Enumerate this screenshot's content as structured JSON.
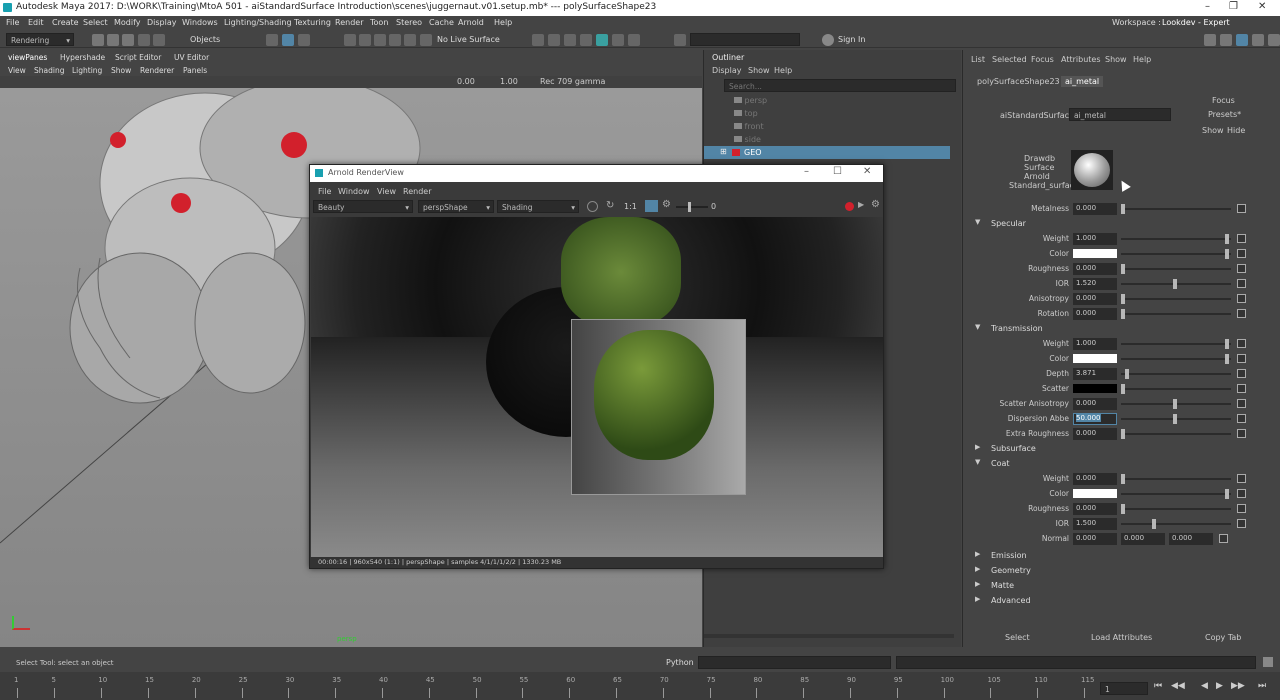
{
  "window": {
    "title": "Autodesk Maya 2017: D:\\WORK\\Training\\MtoA 501 - aiStandardSurface Introduction\\scenes\\juggernaut.v01.setup.mb*  ---  polySurfaceShape23",
    "controls": [
      "–",
      "❐",
      "✕"
    ]
  },
  "menubar": {
    "items": [
      "File",
      "Edit",
      "Create",
      "Select",
      "Modify",
      "Display",
      "Windows",
      "Lighting/Shading",
      "Texturing",
      "Render",
      "Toon",
      "Stereo",
      "Cache",
      "Arnold",
      "Help"
    ],
    "workspace_label": "Workspace :",
    "workspace_value": "Lookdev - Expert"
  },
  "shelf": {
    "menu_set": "Rendering",
    "objects_label": "Objects",
    "live_surface": "No Live Surface",
    "sign_in": "Sign In"
  },
  "viewport": {
    "tabs": [
      "viewPanes",
      "Hypershade",
      "Script Editor",
      "UV Editor"
    ],
    "menu": [
      "View",
      "Shading",
      "Lighting",
      "Show",
      "Renderer",
      "Panels"
    ],
    "field_a": "0.00",
    "field_b": "1.00",
    "color_space": "Rec 709 gamma",
    "camera_label": "persp"
  },
  "outliner": {
    "title": "Outliner",
    "menu": [
      "Display",
      "Show",
      "Help"
    ],
    "search_placeholder": "Search...",
    "items": [
      "persp",
      "top",
      "front",
      "side",
      "GEO"
    ]
  },
  "renderview": {
    "title": "Arnold RenderView",
    "menu": [
      "File",
      "Window",
      "View",
      "Render"
    ],
    "aov": "Beauty",
    "camera": "perspShape",
    "shading": "Shading",
    "ratio": "1:1",
    "exposure": "0",
    "status": "00:00:16 | 960x540 (1:1) | perspShape | samples 4/1/1/1/2/2 | 1330.23 MB"
  },
  "attr_editor": {
    "menu": [
      "List",
      "Selected",
      "Focus",
      "Attributes",
      "Show",
      "Help"
    ],
    "tabs": [
      "polySurfaceShape23",
      "ai_metal"
    ],
    "type_label": "aiStandardSurface:",
    "node_name": "ai_metal",
    "focus_btn": "Focus",
    "presets_btn": "Presets*",
    "show_btn": "Show",
    "hide_btn": "Hide",
    "swatch_caption": [
      "Drawdb",
      "Surface",
      "Arnold",
      "Standard_surface"
    ],
    "metalness": {
      "label": "Metalness",
      "value": "0.000",
      "level": 0.0
    },
    "sections": {
      "specular": "Specular",
      "transmission": "Transmission",
      "subsurface": "Subsurface",
      "coat": "Coat",
      "emission": "Emission",
      "geometry": "Geometry",
      "matte": "Matte",
      "advanced": "Advanced"
    },
    "specular_rows": [
      {
        "label": "Weight",
        "value": "1.000",
        "level": 1.0
      },
      {
        "label": "Color",
        "swatch": "#ffffff"
      },
      {
        "label": "Roughness",
        "value": "0.000",
        "level": 0.0
      },
      {
        "label": "IOR",
        "value": "1.520",
        "level": 0.5
      },
      {
        "label": "Anisotropy",
        "value": "0.000",
        "level": 0.0
      },
      {
        "label": "Rotation",
        "value": "0.000",
        "level": 0.0
      }
    ],
    "transmission_rows": [
      {
        "label": "Weight",
        "value": "1.000",
        "level": 1.0
      },
      {
        "label": "Color",
        "swatch": "#ffffff"
      },
      {
        "label": "Depth",
        "value": "3.871",
        "level": 0.04
      },
      {
        "label": "Scatter",
        "swatch": "#000000"
      },
      {
        "label": "Scatter Anisotropy",
        "value": "0.000",
        "level": 0.5
      },
      {
        "label": "Dispersion Abbe",
        "value": "50.000",
        "level": 0.5
      },
      {
        "label": "Extra Roughness",
        "value": "0.000",
        "level": 0.0
      }
    ],
    "coat_rows": [
      {
        "label": "Weight",
        "value": "0.000",
        "level": 0.0
      },
      {
        "label": "Color",
        "swatch": "#ffffff"
      },
      {
        "label": "Roughness",
        "value": "0.000",
        "level": 0.0
      },
      {
        "label": "IOR",
        "value": "1.500",
        "level": 0.3
      }
    ],
    "normal": {
      "label": "Normal",
      "values": [
        "0.000",
        "0.000",
        "0.000"
      ]
    },
    "bottom_buttons": [
      "Select",
      "Load Attributes",
      "Copy Tab"
    ]
  },
  "status": {
    "help_line": "Select Tool: select an object",
    "python_label": "Python"
  },
  "timeline": {
    "ticks": [
      "1",
      "5",
      "10",
      "15",
      "20",
      "25",
      "30",
      "35",
      "40",
      "45",
      "50",
      "55",
      "60",
      "65",
      "70",
      "75",
      "80",
      "85",
      "90",
      "95",
      "100",
      "105",
      "110",
      "115"
    ],
    "current_frame": "1"
  },
  "colors": {
    "accent": "#5285a6",
    "selected": "#5285a6",
    "record": "#d2202c"
  }
}
